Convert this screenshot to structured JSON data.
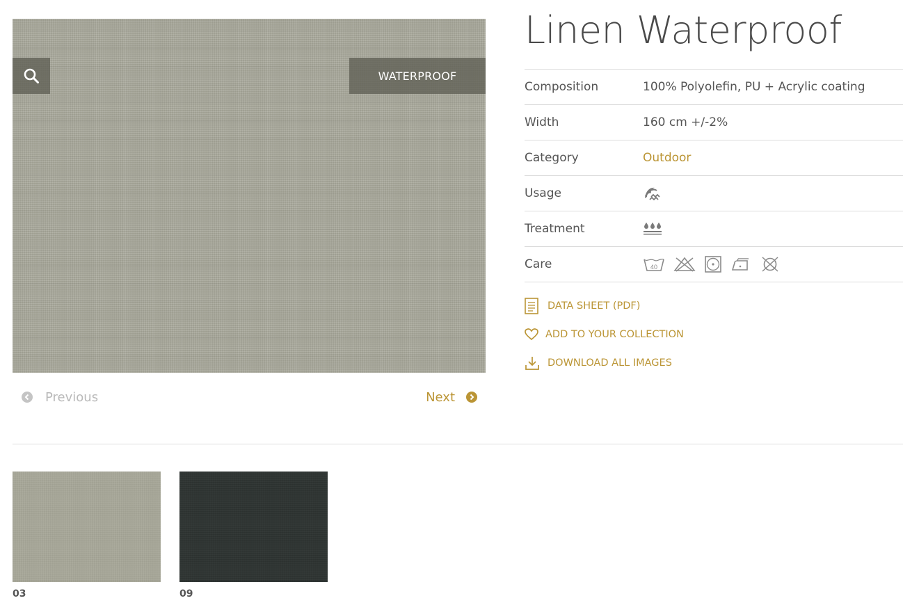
{
  "product": {
    "title": "Linen Waterproof",
    "badge": "WATERPROOF",
    "image_icon": "search-icon"
  },
  "navigation": {
    "previous_label": "Previous",
    "next_label": "Next"
  },
  "specs": {
    "composition": {
      "label": "Composition",
      "value": "100% Polyolefin, PU + Acrylic coating"
    },
    "width": {
      "label": "Width",
      "value": "160 cm +/-2%"
    },
    "category": {
      "label": "Category",
      "value": "Outdoor"
    },
    "usage": {
      "label": "Usage",
      "icon": "outdoor-usage-icon"
    },
    "treatment": {
      "label": "Treatment",
      "icon": "waterproof-treatment-icon"
    },
    "care": {
      "label": "Care",
      "icons": [
        "wash-40-icon",
        "no-bleach-icon",
        "tumble-dry-icon",
        "iron-icon",
        "no-dry-clean-icon"
      ],
      "wash_temp": "40"
    }
  },
  "actions": {
    "data_sheet": "DATA SHEET (PDF)",
    "add_collection": "ADD TO YOUR COLLECTION",
    "download_images": "DOWNLOAD ALL IMAGES"
  },
  "variants": [
    {
      "code": "03",
      "color": "#a7a798"
    },
    {
      "code": "09",
      "color": "#2d3331"
    }
  ],
  "colors": {
    "accent": "#bb9535",
    "text": "#555555",
    "divider": "#dcdcdc",
    "overlay": "#5f5f55"
  }
}
